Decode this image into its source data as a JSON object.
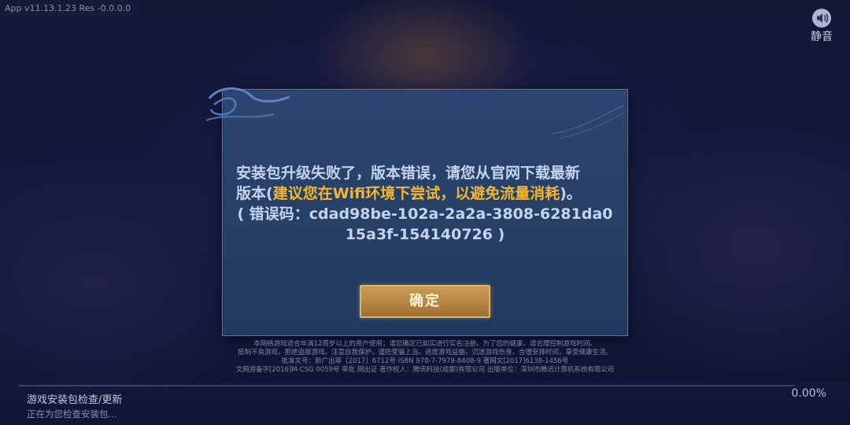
{
  "top_bar": {
    "version_text": "App v11.13.1.23  Res -0.0.0.0"
  },
  "mute": {
    "icon": "speaker-icon",
    "label": "静音"
  },
  "dialog": {
    "message_line1": "安装包升级失败了，版本错误，请您从官网下载最新",
    "message_line2_prefix": "版本(",
    "message_line2_highlight": "建议您在Wifi环境下尝试，以避免流量消耗",
    "message_line2_suffix": ")。",
    "error_code_line1": "( 错误码：cdad98be-102a-2a2a-3808-6281da0",
    "error_code_line2": "15a3f-154140726 )",
    "confirm_label": "确定",
    "highlight_color": "#f3b633"
  },
  "legal": {
    "line1": "本网络游戏适合年满12周岁以上的用户使用；请您确定已如实进行实名注册，为了您的健康，请合理控制游戏时间。",
    "line2": "抵制不良游戏，拒绝盗版游戏。注意自我保护，谨防受骗上当。适度游戏益脑，沉迷游戏伤身。合理安排时间，享受健康生活。",
    "line3": "批准文号：新广出审［2017］6712号  ISBN 978-7-7979-8408-9  著网文[2017]6138-1456号",
    "line4": "文网游备字[2016]M-CSG 0059号  审批  网出证  著作权人：腾讯科技(成都)有限公司  出版单位：深圳市腾讯计算机系统有限公司"
  },
  "status": {
    "title": "游戏安装包检查/更新",
    "subtitle": "正在为您检查安装包...",
    "progress_text": "0.00%",
    "progress_value": 0
  }
}
